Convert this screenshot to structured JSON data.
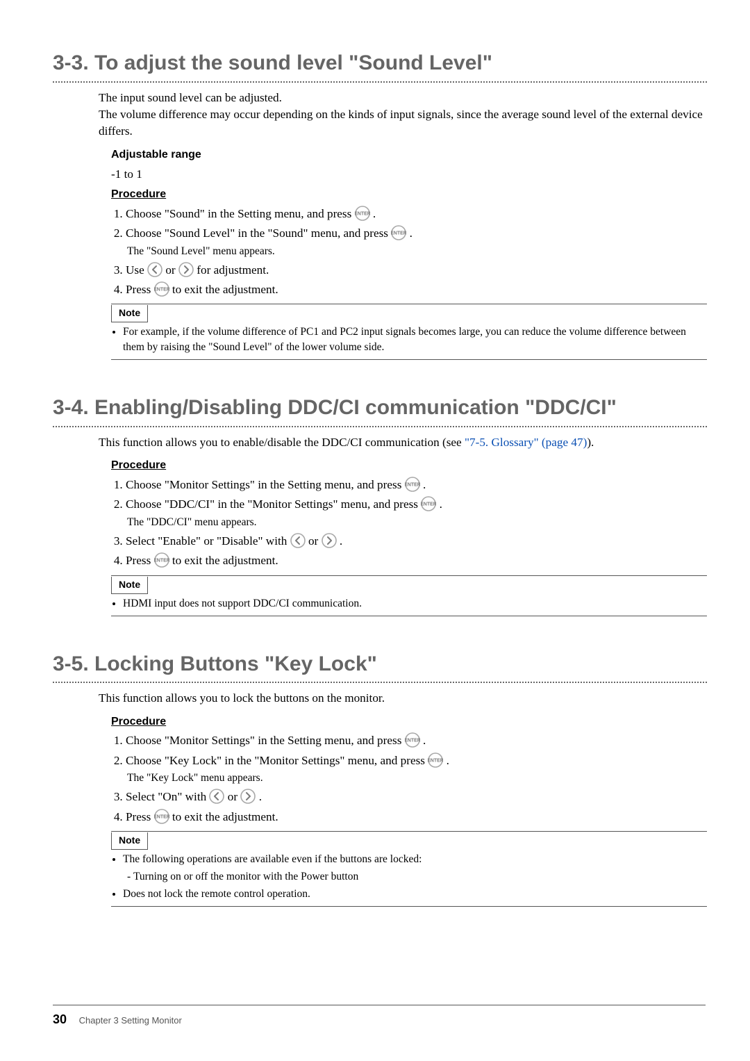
{
  "sections": [
    {
      "id": "3-3",
      "title": "3-3.  To adjust the sound level \"Sound Level\"",
      "intro": [
        "The input sound level can be adjusted.",
        "The volume difference may occur depending on the kinds of input signals, since the average sound level of the external device differs."
      ],
      "blocks": [
        {
          "type": "heading",
          "text": "Adjustable range"
        },
        {
          "type": "line",
          "text": "-1 to 1"
        },
        {
          "type": "heading_u",
          "text": "Procedure"
        },
        {
          "type": "steps",
          "items": [
            {
              "pre": "Choose \"Sound\" in the Setting menu, and press ",
              "icon": "enter",
              "post": "."
            },
            {
              "pre": "Choose \"Sound Level\" in the \"Sound\" menu, and press ",
              "icon": "enter",
              "post": ".",
              "sub": "The \"Sound Level\" menu appears."
            },
            {
              "pre": "Use ",
              "icon": "left",
              "mid": " or ",
              "icon2": "right",
              "post": " for adjustment."
            },
            {
              "pre": "Press ",
              "icon": "enter",
              "post": " to exit the adjustment."
            }
          ]
        }
      ],
      "note_label": "Note",
      "notes": [
        "For example, if the volume difference of PC1 and PC2 input signals becomes large, you can reduce the volume difference between them by raising the \"Sound Level\" of the lower volume side."
      ]
    },
    {
      "id": "3-4",
      "title": "3-4.  Enabling/Disabling DDC/CI communication \"DDC/CI\"",
      "intro_rich": {
        "pre": "This function allows you to enable/disable the DDC/CI communication (see ",
        "link": "\"7-5. Glossary\" (page 47)",
        "post": ")."
      },
      "blocks": [
        {
          "type": "heading_u",
          "text": "Procedure"
        },
        {
          "type": "steps",
          "items": [
            {
              "pre": "Choose \"Monitor Settings\" in the Setting menu, and press ",
              "icon": "enter",
              "post": "."
            },
            {
              "pre": "Choose \"DDC/CI\" in the \"Monitor Settings\" menu, and press ",
              "icon": "enter",
              "post": ".",
              "sub": "The \"DDC/CI\" menu appears."
            },
            {
              "pre": "Select \"Enable\" or \"Disable\" with ",
              "icon": "left",
              "mid": " or ",
              "icon2": "right",
              "post": "."
            },
            {
              "pre": "Press ",
              "icon": "enter",
              "post": " to exit the adjustment."
            }
          ]
        }
      ],
      "note_label": "Note",
      "notes": [
        "HDMI input does not support DDC/CI communication."
      ]
    },
    {
      "id": "3-5",
      "title": "3-5.  Locking Buttons \"Key Lock\"",
      "intro": [
        "This function allows you to lock the buttons on the monitor."
      ],
      "blocks": [
        {
          "type": "heading_u",
          "text": "Procedure"
        },
        {
          "type": "steps",
          "items": [
            {
              "pre": "Choose \"Monitor Settings\" in the Setting menu, and press ",
              "icon": "enter",
              "post": "."
            },
            {
              "pre": "Choose \"Key Lock\" in the \"Monitor Settings\" menu, and press ",
              "icon": "enter",
              "post": ".",
              "sub": "The \"Key Lock\" menu appears."
            },
            {
              "pre": "Select \"On\" with ",
              "icon": "left",
              "mid": " or ",
              "icon2": "right",
              "post": "."
            },
            {
              "pre": "Press ",
              "icon": "enter",
              "post": " to exit the adjustment."
            }
          ]
        }
      ],
      "note_label": "Note",
      "notes": [
        {
          "text": "The following operations are available even if the buttons are locked:",
          "sub": [
            "Turning on or off the monitor with the Power button"
          ]
        },
        "Does not lock the remote control operation."
      ]
    }
  ],
  "footer": {
    "page": "30",
    "chapter": "Chapter 3  Setting Monitor"
  }
}
